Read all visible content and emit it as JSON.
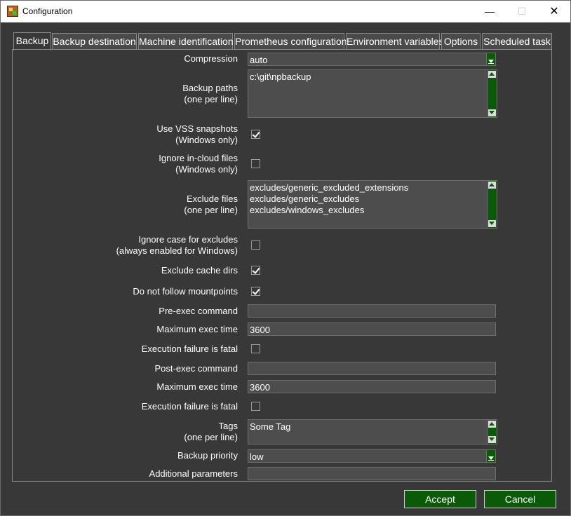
{
  "window": {
    "title": "Configuration",
    "min_glyph": "—",
    "max_glyph": "☐",
    "close_glyph": "✕"
  },
  "tabs": [
    {
      "label": "Backup",
      "active": true
    },
    {
      "label": "Backup destination"
    },
    {
      "label": "Machine identification"
    },
    {
      "label": "Prometheus configuration"
    },
    {
      "label": "Environment variables"
    },
    {
      "label": "Options"
    },
    {
      "label": "Scheduled task"
    }
  ],
  "form": {
    "compression": {
      "label": "Compression",
      "value": "auto"
    },
    "backup_paths": {
      "label_1": "Backup paths",
      "label_2": "(one per line)",
      "value": "c:\\git\\npbackup"
    },
    "use_vss": {
      "label_1": "Use VSS snapshots",
      "label_2": "(Windows only)",
      "checked": true
    },
    "ignore_cloud": {
      "label_1": "Ignore in-cloud files",
      "label_2": "(Windows only)",
      "checked": false
    },
    "exclude_files": {
      "label_1": "Exclude files",
      "label_2": "(one per line)",
      "value": "excludes/generic_excluded_extensions\nexcludes/generic_excludes\nexcludes/windows_excludes"
    },
    "ignore_case": {
      "label_1": "Ignore case for excludes",
      "label_2": "(always enabled for Windows)",
      "checked": false
    },
    "exclude_cache": {
      "label": "Exclude cache dirs",
      "checked": true
    },
    "no_mountpoints": {
      "label": "Do not follow mountpoints",
      "checked": true
    },
    "pre_exec": {
      "label": "Pre-exec command",
      "value": ""
    },
    "pre_max_time": {
      "label": "Maximum exec time",
      "value": "3600"
    },
    "pre_fatal": {
      "label": "Execution failure is fatal",
      "checked": false
    },
    "post_exec": {
      "label": "Post-exec command",
      "value": ""
    },
    "post_max_time": {
      "label": "Maximum exec time",
      "value": "3600"
    },
    "post_fatal": {
      "label": "Execution failure is fatal",
      "checked": false
    },
    "tags": {
      "label_1": "Tags",
      "label_2": "(one per line)",
      "value": "Some Tag"
    },
    "priority": {
      "label": "Backup priority",
      "value": "low"
    },
    "additional": {
      "label": "Additional parameters",
      "value": ""
    }
  },
  "buttons": {
    "accept": "Accept",
    "cancel": "Cancel"
  },
  "colors": {
    "background": "#383838",
    "accent_green": "#0a5a0a",
    "field": "#4d4d4d",
    "text": "#ffffff"
  }
}
